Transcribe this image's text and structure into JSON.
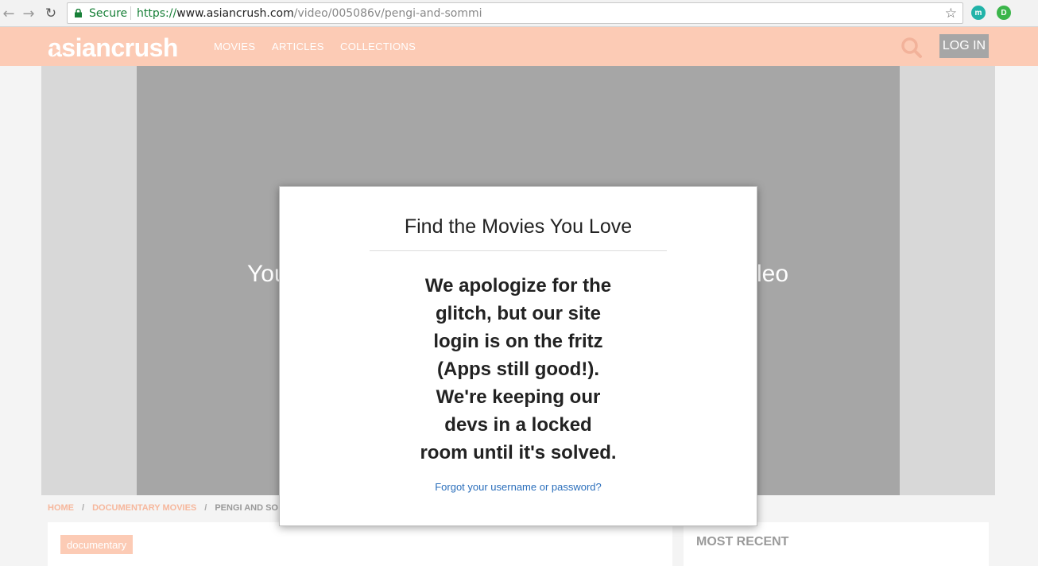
{
  "browser": {
    "secure_label": "Secure",
    "url_scheme": "https://",
    "url_host": "www.asiancrush.com",
    "url_path": "/video/005086v/pengi-and-sommi",
    "extensions": [
      "m",
      "D"
    ]
  },
  "site": {
    "logo_text": "asiancrush",
    "nav": {
      "movies": "MOVIES",
      "articles": "ARTICLES",
      "collections": "COLLECTIONS"
    },
    "login_label": "LOG IN",
    "colors": {
      "header_bg": "#fccbb5",
      "login_bg": "#a6a6a6",
      "link_blue": "#2a6ebb"
    }
  },
  "player": {
    "message_left": "You",
    "message_right": "leo"
  },
  "breadcrumb": {
    "home": "HOME",
    "category": "DOCUMENTARY MOVIES",
    "current": "PENGI AND SO"
  },
  "content": {
    "tag": "documentary",
    "most_recent_title": "MOST RECENT"
  },
  "modal": {
    "title": "Find the Movies You Love",
    "message_lines": [
      "We apologize for the",
      "glitch, but our site",
      "login is on the fritz",
      "(Apps still good!).",
      "We're keeping our",
      "devs in a locked",
      "room until it's solved."
    ],
    "forgot_link": "Forgot your username or password?"
  }
}
